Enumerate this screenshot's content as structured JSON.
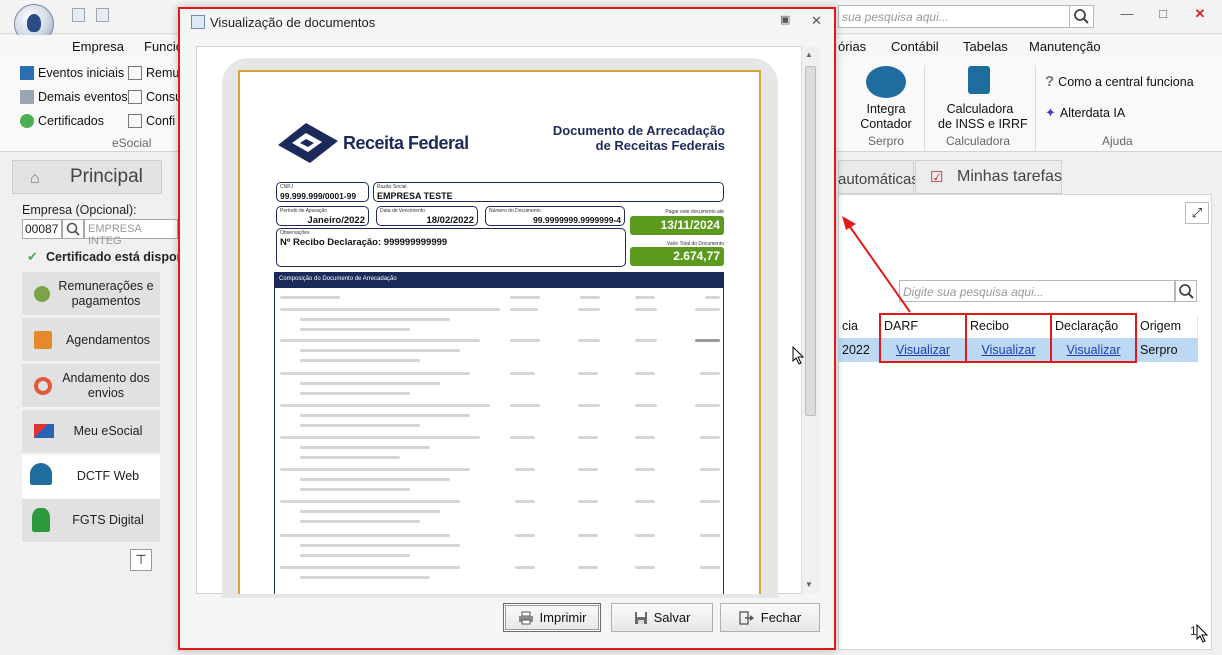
{
  "app": {
    "search_placeholder": "sua pesquisa aqui...",
    "menu": [
      "Empresa",
      "Funcio",
      "órias",
      "Contábil",
      "Tabelas",
      "Manutenção"
    ],
    "ribbon": {
      "esocial_items": [
        "Eventos iniciais",
        "Demais eventos",
        "Certificados"
      ],
      "esocial_items2": [
        "Remu",
        "Consu",
        "Confi"
      ],
      "esocial_group": "eSocial",
      "serpro_button": "Integra\nContador",
      "serpro_group": "Serpro",
      "calc_button": "Calculadora\nde INSS e IRRF",
      "calc_group": "Calculadora",
      "ajuda_items": [
        "Como a central funciona",
        "Alterdata IA"
      ],
      "ajuda_group": "Ajuda"
    },
    "tabs": {
      "principal": "Principal",
      "automaticas": "automáticas",
      "minhas_tarefas": "Minhas tarefas"
    },
    "empresa_label": "Empresa (Opcional):",
    "empresa_code": "00087",
    "empresa_name": "EMPRESA INTEG",
    "cert_status": "Certificado está disponí",
    "side_items": [
      "Remunerações e\npagamentos",
      "Agendamentos",
      "Andamento dos\nenvios",
      "Meu eSocial",
      "DCTF Web",
      "FGTS Digital"
    ],
    "grid": {
      "search_placeholder": "Digite sua pesquisa aqui...",
      "columns": [
        "cia",
        "DARF",
        "Recibo",
        "Declaração",
        "Origem"
      ],
      "row": {
        "cia": "2022",
        "darf": "Visualizar",
        "recibo": "Visualizar",
        "declaracao": "Visualizar",
        "origem": "Serpro"
      },
      "count": "1"
    }
  },
  "modal": {
    "title": "Visualização de documentos",
    "buttons": {
      "print": "Imprimir",
      "save": "Salvar",
      "close": "Fechar"
    },
    "document": {
      "brand": "Receita Federal",
      "heading_line1": "Documento de Arrecadação",
      "heading_line2": "de Receitas Federais",
      "cnpj_label": "CNPJ",
      "cnpj": "99.999.999/0001-99",
      "razao_label": "Razão Social",
      "razao": "EMPRESA TESTE",
      "periodo_label": "Período de Apuração",
      "periodo": "Janeiro/2022",
      "vencimento_label": "Data de Vencimento",
      "vencimento": "18/02/2022",
      "numero_label": "Número do Documento",
      "numero": "99.9999999.9999999-4",
      "pagar_label": "Pagar este documento até",
      "pagar": "13/11/2024",
      "obs_label": "Observações",
      "obs": "Nº Recibo Declaração: 999999999999",
      "valor_label": "Valor Total do Documento",
      "valor": "2.674,77",
      "composicao": "Composição do Documento de Arrecadação"
    }
  },
  "colors": {
    "accent_red": "#e01a1a",
    "brand_navy": "#1c2a5a",
    "green": "#5c9a1e",
    "selection": "#bcd8f2"
  }
}
